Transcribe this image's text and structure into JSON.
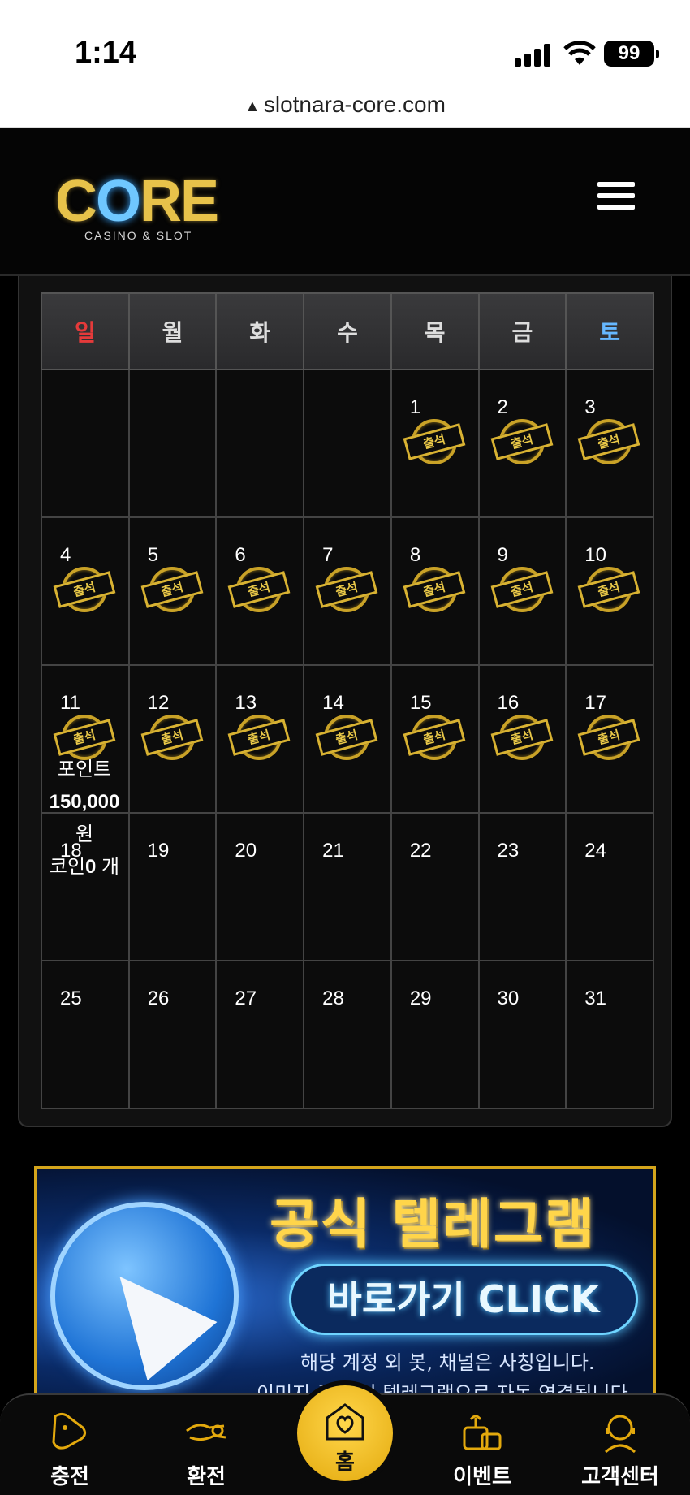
{
  "status_bar": {
    "time": "1:14",
    "battery": "99"
  },
  "url_bar": {
    "url": "slotnara-core.com"
  },
  "header": {
    "logo_text": "CORE",
    "logo_sub": "CASINO & SLOT"
  },
  "calendar": {
    "weekdays": [
      "일",
      "월",
      "화",
      "수",
      "목",
      "금",
      "토"
    ],
    "stamp_label": "출석",
    "weeks": [
      [
        {
          "day": "",
          "stamp": false
        },
        {
          "day": "",
          "stamp": false
        },
        {
          "day": "",
          "stamp": false
        },
        {
          "day": "",
          "stamp": false
        },
        {
          "day": "1",
          "stamp": true
        },
        {
          "day": "2",
          "stamp": true
        },
        {
          "day": "3",
          "stamp": true
        }
      ],
      [
        {
          "day": "4",
          "stamp": true
        },
        {
          "day": "5",
          "stamp": true
        },
        {
          "day": "6",
          "stamp": true
        },
        {
          "day": "7",
          "stamp": true
        },
        {
          "day": "8",
          "stamp": true
        },
        {
          "day": "9",
          "stamp": true
        },
        {
          "day": "10",
          "stamp": true
        }
      ],
      [
        {
          "day": "11",
          "stamp": true
        },
        {
          "day": "12",
          "stamp": true
        },
        {
          "day": "13",
          "stamp": true
        },
        {
          "day": "14",
          "stamp": true
        },
        {
          "day": "15",
          "stamp": true
        },
        {
          "day": "16",
          "stamp": true
        },
        {
          "day": "17",
          "stamp": true
        }
      ],
      [
        {
          "day": "18",
          "stamp": false
        },
        {
          "day": "19",
          "stamp": false
        },
        {
          "day": "20",
          "stamp": false
        },
        {
          "day": "21",
          "stamp": false
        },
        {
          "day": "22",
          "stamp": false
        },
        {
          "day": "23",
          "stamp": false
        },
        {
          "day": "24",
          "stamp": false
        }
      ],
      [
        {
          "day": "25",
          "stamp": false
        },
        {
          "day": "26",
          "stamp": false
        },
        {
          "day": "27",
          "stamp": false
        },
        {
          "day": "28",
          "stamp": false
        },
        {
          "day": "29",
          "stamp": false
        },
        {
          "day": "30",
          "stamp": false
        },
        {
          "day": "31",
          "stamp": false
        }
      ]
    ],
    "point_overlay": {
      "point_label": "포인트",
      "point_value": "150,000",
      "point_unit": "원",
      "coin_label": "코인",
      "coin_value": "0",
      "coin_unit": " 개"
    }
  },
  "banner": {
    "title": "공식 텔레그램",
    "button": "바로가기 CLICK",
    "line1": "해당 계정 외 봇, 채널은 사칭입니다.",
    "line2": "이미지 클릭 시 텔레그램으로 자동 연결됩니다."
  },
  "bottom_nav": {
    "charge": "충전",
    "exchange": "환전",
    "home": "홈",
    "event": "이벤트",
    "support": "고객센터"
  },
  "colors": {
    "accent_gold": "#e3a90d",
    "sunday": "#e53a3a",
    "saturday": "#66b8ff",
    "telegram_blue": "#1f74d6"
  }
}
